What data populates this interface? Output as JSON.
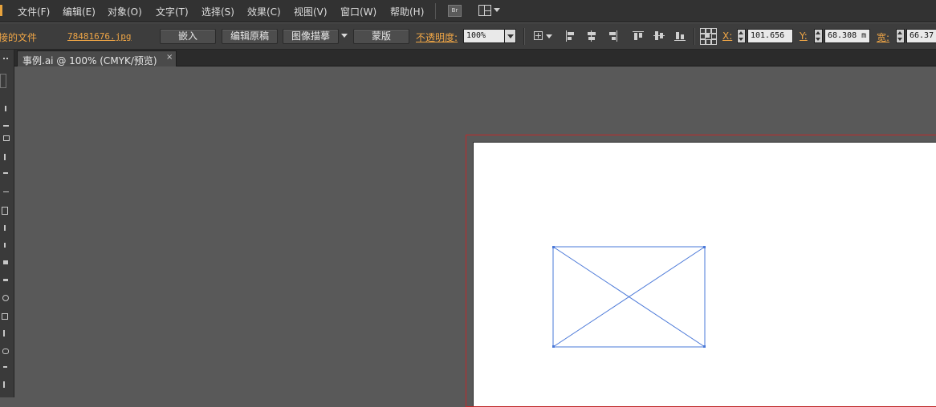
{
  "menubar": {
    "items": [
      "文件(F)",
      "编辑(E)",
      "对象(O)",
      "文字(T)",
      "选择(S)",
      "效果(C)",
      "视图(V)",
      "窗口(W)",
      "帮助(H)"
    ],
    "bridge_label": "Br",
    "workspace_icon": "workspace-switcher-icon"
  },
  "controlbar": {
    "linked_file_label": "链接的文件",
    "linked_file_visible": "接的文件",
    "file_name": "78481676.jpg",
    "embed_label": "嵌入",
    "edit_original_label": "编辑原稿",
    "image_trace_label": "图像描摹",
    "mask_label": "蒙版",
    "opacity_label": "不透明度:",
    "opacity_value": "100%",
    "x_label": "X:",
    "x_value": "101.656",
    "x_unit_partial": "r",
    "y_label": "Y:",
    "y_value": "68.308 m",
    "w_label": "宽:",
    "w_value": "66.37"
  },
  "document": {
    "tab_title": "事例.ai @ 100% (CMYK/预览)",
    "close_symbol": "×"
  },
  "colors": {
    "accent_orange": "#f0a646",
    "artboard_bleed": "#c0282a",
    "selection_blue": "#4a78d8"
  }
}
